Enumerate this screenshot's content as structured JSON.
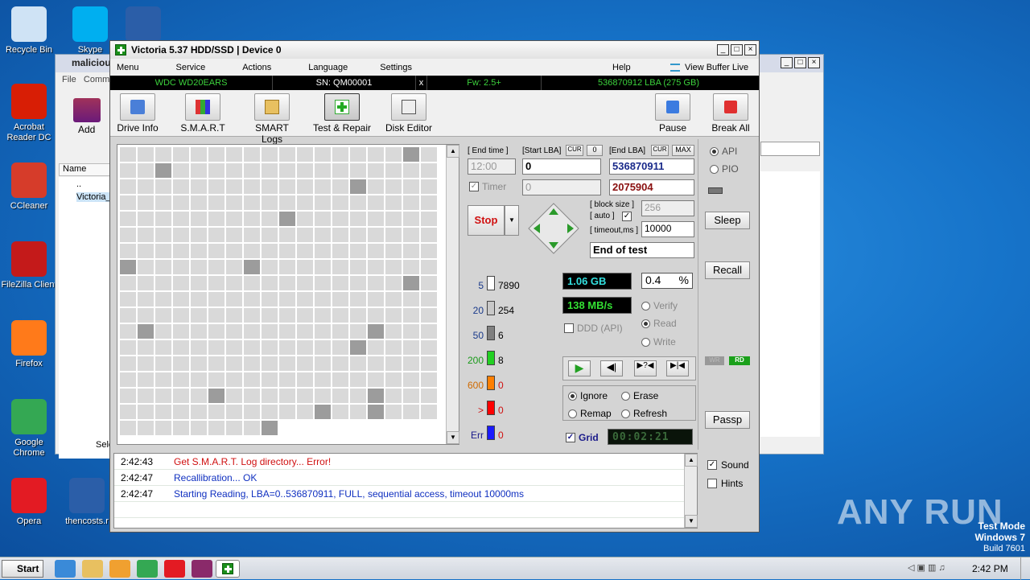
{
  "desktop": {
    "icons": [
      {
        "label": "Recycle Bin",
        "color": "#cfe3f5"
      },
      {
        "label": "Skype",
        "color": "#00aff0"
      },
      {
        "label": "",
        "color": "#2b5ea8"
      },
      {
        "label": "Acrobat Reader DC",
        "color": "#d81e05"
      },
      {
        "label": "CCleaner",
        "color": "#d63c2a"
      },
      {
        "label": "FileZilla Client",
        "color": "#c41a1a"
      },
      {
        "label": "Firefox",
        "color": "#ff7a1a"
      },
      {
        "label": "Google Chrome",
        "color": "#34a853"
      },
      {
        "label": "Opera",
        "color": "#e31b23"
      },
      {
        "label": "thencosts.r",
        "color": "#2b5ea8"
      }
    ],
    "watermark": "ANY RUN",
    "test_mode": {
      "line1": "Test Mode",
      "line2": "Windows 7",
      "line3": "Build 7601"
    }
  },
  "back_window": {
    "title": "maliciou",
    "menu": [
      "File",
      "Comma"
    ],
    "add_label": "Add",
    "col_name": "Name",
    "rows": [
      "..",
      "Victoria_"
    ],
    "status": "Sele"
  },
  "window": {
    "title": "Victoria 5.37 HDD/SSD | Device 0",
    "controls": [
      "_",
      "□",
      "×"
    ]
  },
  "menu": {
    "items": [
      "Menu",
      "Service",
      "Actions",
      "Language",
      "Settings"
    ],
    "help": "Help",
    "view_buffer": "View Buffer Live"
  },
  "info": {
    "model": "WDC WD20EARS",
    "serial": "SN: QM00001",
    "close": "x",
    "firmware": "Fw: 2.5+",
    "lba": "536870912 LBA (275 GB)"
  },
  "toolbar": {
    "buttons": [
      "Drive Info",
      "S.M.A.R.T",
      "SMART Logs",
      "Test & Repair",
      "Disk Editor"
    ],
    "pause": "Pause",
    "break_all": "Break All"
  },
  "controls": {
    "end_time_label": "[ End time ]",
    "start_lba_label": "[Start LBA]",
    "cur": "CUR",
    "zero": "0",
    "end_lba_label": "[End LBA]",
    "max": "MAX",
    "end_time": "12:00",
    "start_lba": "0",
    "end_lba": "536870911",
    "timer_label": "Timer",
    "timer_value": "0",
    "remain_lba": "2075904",
    "stop": "Stop",
    "block_size_label": "[ block size ]",
    "auto_label": "[ auto ]",
    "block_size": "256",
    "timeout_label": "[ timeout,ms ]",
    "timeout": "10000",
    "end_action": "End of test"
  },
  "legend": [
    {
      "ms": "5",
      "count": "7890",
      "color": "#ffffff"
    },
    {
      "ms": "20",
      "count": "254",
      "color": "#c8c8c8"
    },
    {
      "ms": "50",
      "count": "6",
      "color": "#808080"
    },
    {
      "ms": "200",
      "count": "8",
      "color": "#22d022"
    },
    {
      "ms": "600",
      "count": "0",
      "color": "#ff7f00"
    },
    {
      "ms": ">",
      "count": "0",
      "color": "#ff0000"
    },
    {
      "ms": "Err",
      "count": "0",
      "color": "#1a1aff"
    }
  ],
  "status": {
    "size": "1.06 GB",
    "percent": "0.4",
    "pct_sign": "%",
    "speed": "138 MB/s",
    "ddd": "DDD (API)",
    "verify": "Verify",
    "read": "Read",
    "write": "Write"
  },
  "repair": {
    "ignore": "Ignore",
    "erase": "Erase",
    "remap": "Remap",
    "refresh": "Refresh",
    "grid": "Grid",
    "timer": "00:02:21"
  },
  "right_panel": {
    "api": "API",
    "pio": "PIO",
    "sleep": "Sleep",
    "recall": "Recall",
    "wr": "WR",
    "rd": "RD",
    "passp": "Passp",
    "sound": "Sound",
    "hints": "Hints"
  },
  "log": [
    {
      "time": "2:42:43",
      "text": "Get S.M.A.R.T. Log directory... Error!",
      "color": "#d01010"
    },
    {
      "time": "2:42:47",
      "text": "Recallibration... OK",
      "color": "#1030c0"
    },
    {
      "time": "2:42:47",
      "text": "Starting Reading, LBA=0..536870911, FULL, sequential access, timeout 10000ms",
      "color": "#1030c0"
    }
  ],
  "taskbar": {
    "start": "Start",
    "clock": "2:42 PM"
  }
}
